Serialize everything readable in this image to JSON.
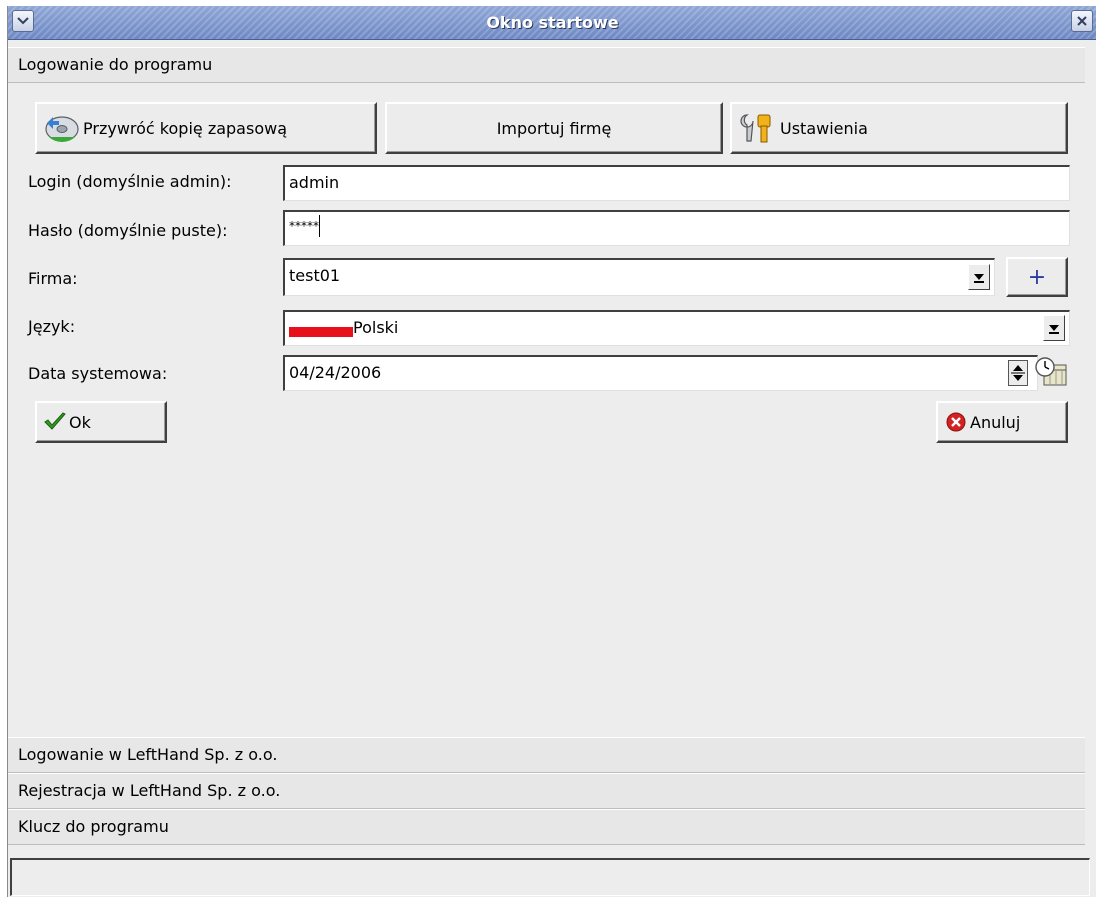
{
  "window": {
    "title": "Okno startowe"
  },
  "sections": {
    "login_program": "Logowanie do programu",
    "login_lefthand": "Logowanie w LeftHand Sp. z o.o.",
    "register_lefthand": "Rejestracja w LeftHand Sp. z o.o.",
    "program_key": "Klucz do programu"
  },
  "toolbar": {
    "restore_backup": "Przywróć kopię zapasową",
    "import_company": "Importuj firmę",
    "settings": "Ustawienia"
  },
  "form": {
    "login_label": "Login (domyślnie admin):",
    "login_value": "admin",
    "password_label": "Hasło (domyślnie puste):",
    "password_value": "*****",
    "company_label": "Firma:",
    "company_value": "test01",
    "add_company": "+",
    "language_label": "Język:",
    "language_value": "Polski",
    "date_label": "Data systemowa:",
    "date_value": "04/24/2006"
  },
  "actions": {
    "ok": "Ok",
    "cancel": "Anuluj"
  },
  "colors": {
    "flag_red": "#e8101a",
    "title_bar": "#7a92cc"
  }
}
